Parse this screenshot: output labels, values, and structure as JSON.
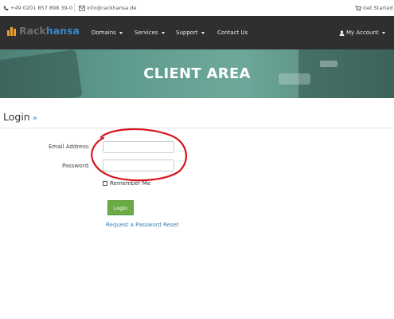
{
  "topbar": {
    "phone": "+49 0201 857 898 39-0",
    "email": "info@rackhansa.de",
    "get_started": "Get Started"
  },
  "brand": {
    "part1": "Rack",
    "part2": "hansa"
  },
  "nav": {
    "items": [
      {
        "label": "Domains",
        "dropdown": true
      },
      {
        "label": "Services",
        "dropdown": true
      },
      {
        "label": "Support",
        "dropdown": true
      },
      {
        "label": "Contact Us",
        "dropdown": false
      }
    ],
    "account": "My Account"
  },
  "hero": {
    "title": "CLIENT AREA"
  },
  "page": {
    "heading": "Login",
    "heading_suffix": "»"
  },
  "form": {
    "email_label": "Email Address:",
    "email_value": "",
    "password_label": "Password:",
    "password_value": "",
    "remember_label": "Remember Me",
    "remember_checked": false,
    "login_button": "Login",
    "reset_link": "Request a Password Reset"
  },
  "colors": {
    "navbar": "#2f2f2f",
    "accent_blue": "#3a87c5",
    "logo_orange": "#f0a030",
    "button_green": "#6aab45",
    "annotation_red": "#d6121a"
  }
}
